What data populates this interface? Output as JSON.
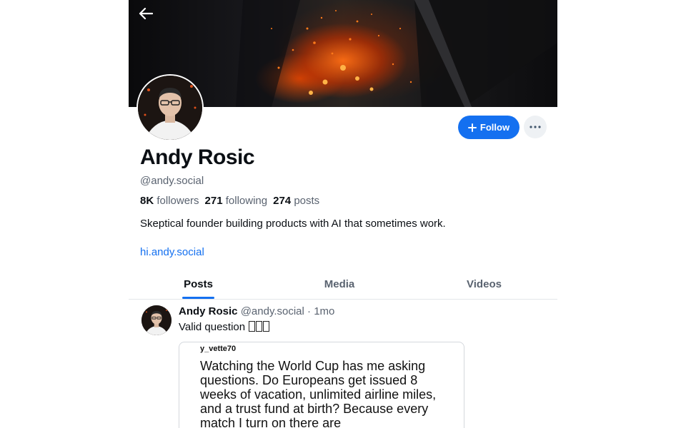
{
  "profile": {
    "display_name": "Andy Rosic",
    "handle": "@andy.social",
    "stats": {
      "followers_count": "8K",
      "followers_label": "followers",
      "following_count": "271",
      "following_label": "following",
      "posts_count": "274",
      "posts_label": "posts"
    },
    "bio": "Skeptical founder building products with AI that sometimes work.",
    "link": "hi.andy.social"
  },
  "actions": {
    "follow_label": "Follow"
  },
  "tabs": [
    {
      "label": "Posts",
      "active": true
    },
    {
      "label": "Media",
      "active": false
    },
    {
      "label": "Videos",
      "active": false
    }
  ],
  "post": {
    "author": "Andy Rosic",
    "handle": "@andy.social",
    "separator": "·",
    "time": "1mo",
    "text": "Valid question",
    "embed": {
      "username": "y_vette70",
      "text": "Watching the World Cup has me asking questions. Do Europeans get issued 8 weeks of vacation, unlimited airline miles, and a trust fund at birth? Because every match I turn on there are"
    }
  },
  "colors": {
    "accent": "#1470f0",
    "muted_text": "#5a6370",
    "divider": "#e3e6ea"
  },
  "icons": {
    "back": "arrow-left-icon",
    "follow": "plus-icon",
    "more": "ellipsis-icon"
  }
}
